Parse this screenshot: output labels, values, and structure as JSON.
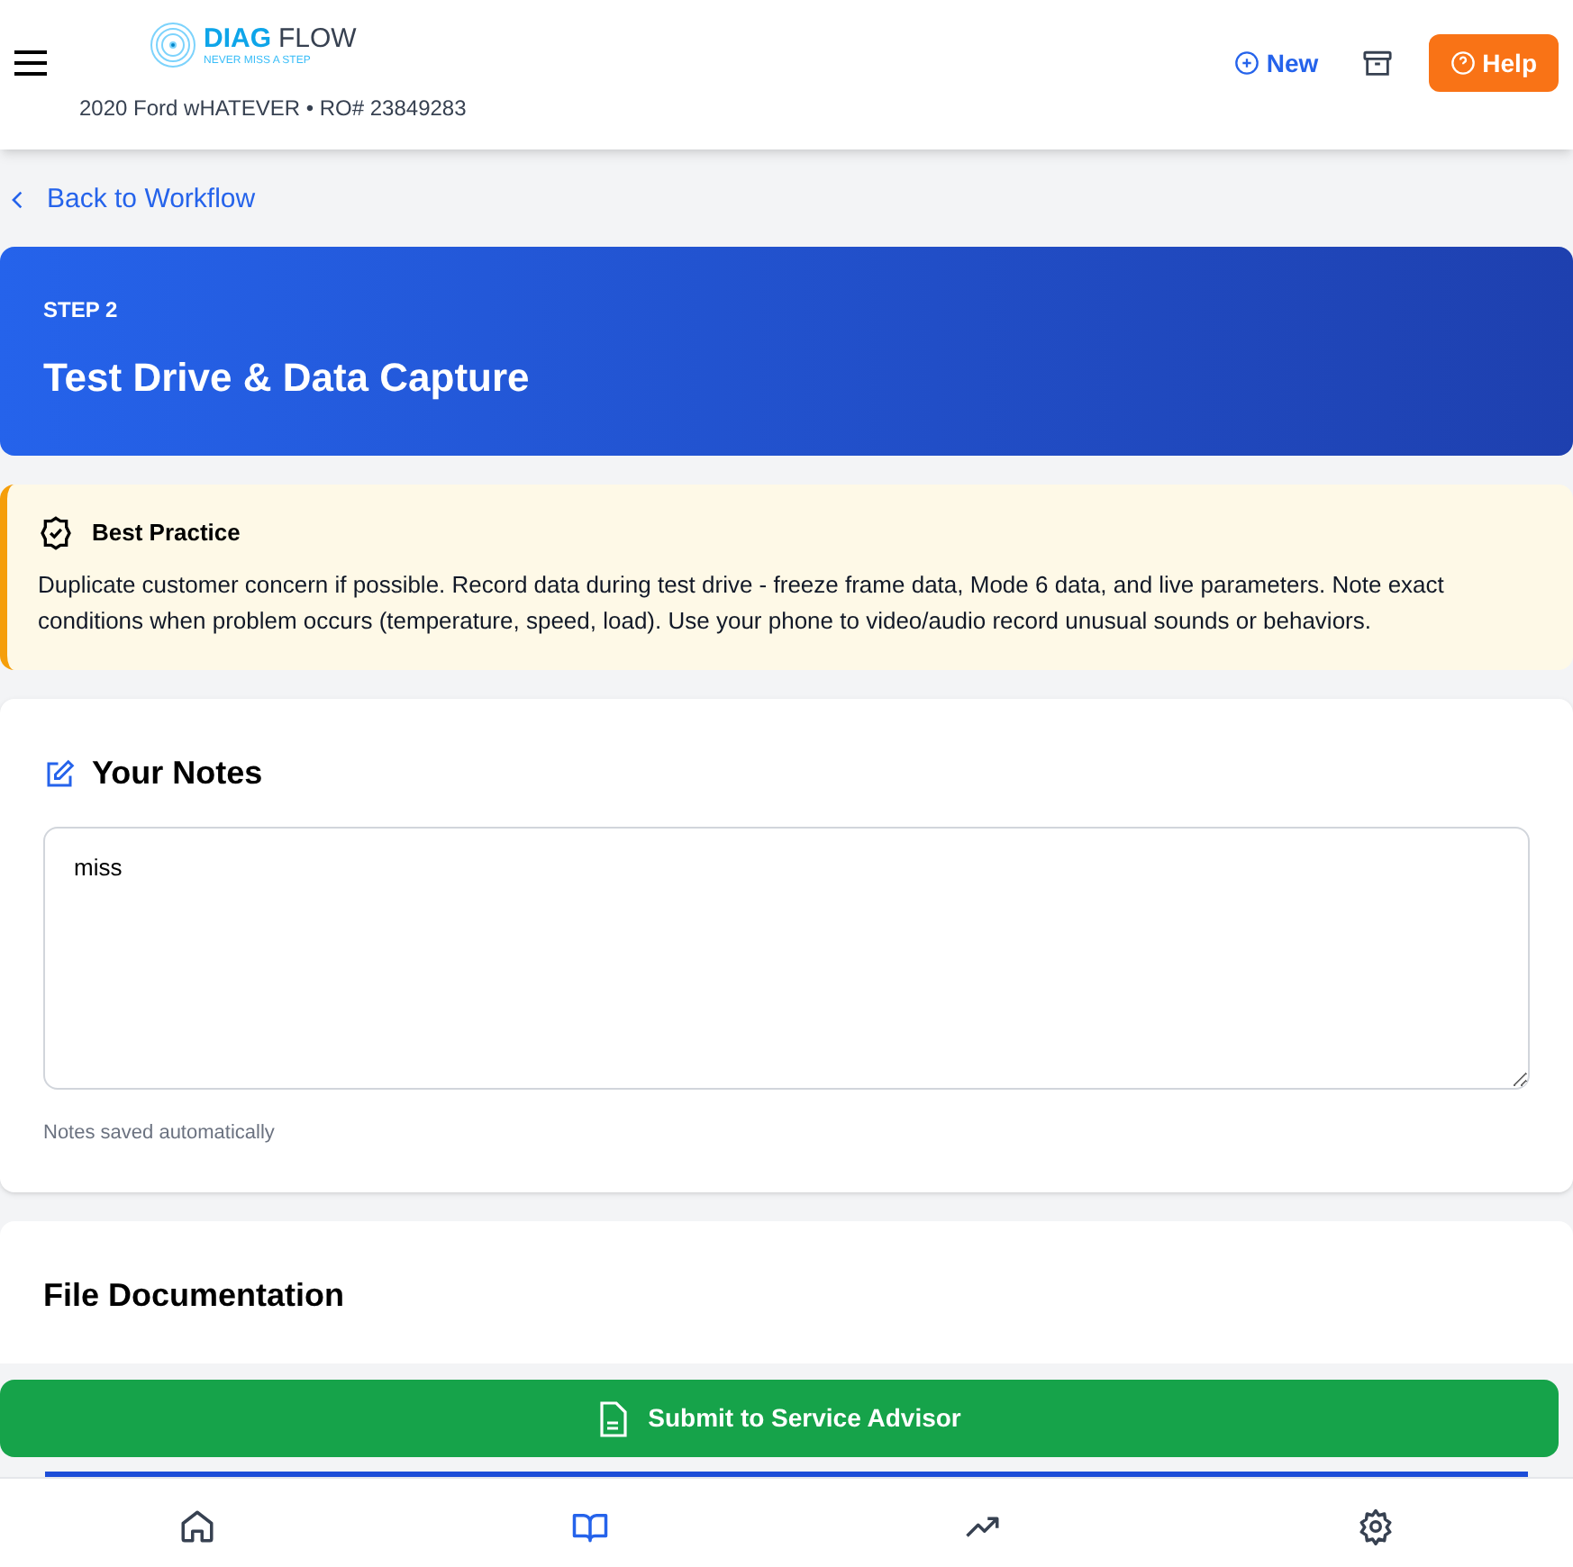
{
  "header": {
    "logo": {
      "word_1": "DIAG",
      "word_2": "FLOW",
      "tagline": "NEVER MISS A STEP"
    },
    "vehicle": "2020 Ford wHATEVER • RO# 23849283",
    "new_button": "New",
    "help_button": "Help"
  },
  "back_link": "Back to Workflow",
  "step": {
    "label": "STEP 2",
    "title": "Test Drive & Data Capture"
  },
  "best_practice": {
    "title": "Best Practice",
    "text": "Duplicate customer concern if possible. Record data during test drive - freeze frame data, Mode 6 data, and live parameters. Note exact conditions when problem occurs (temperature, speed, load). Use your phone to video/audio record unusual sounds or behaviors."
  },
  "notes": {
    "title": "Your Notes",
    "value": "miss",
    "hint": "Notes saved automatically"
  },
  "file_documentation": {
    "title": "File Documentation"
  },
  "submit_button": "Submit to Service Advisor",
  "bottom_nav": [
    {
      "kind": "home",
      "selected": false
    },
    {
      "kind": "book",
      "selected": true
    },
    {
      "kind": "trend",
      "selected": false
    },
    {
      "kind": "settings",
      "selected": false
    }
  ]
}
